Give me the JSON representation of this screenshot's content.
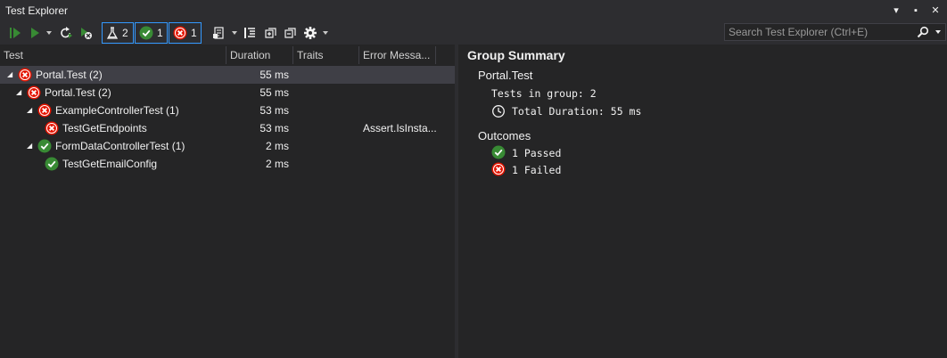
{
  "window": {
    "title": "Test Explorer",
    "controls": {
      "dropdown": "▾",
      "pin": "▪",
      "close": "✕"
    }
  },
  "toolbar": {
    "filters": [
      {
        "name": "total",
        "count": "2"
      },
      {
        "name": "passed",
        "count": "1"
      },
      {
        "name": "failed",
        "count": "1"
      }
    ],
    "search_placeholder": "Search Test Explorer (Ctrl+E)"
  },
  "columns": [
    "Test",
    "Duration",
    "Traits",
    "Error Messa..."
  ],
  "rows": [
    {
      "name": "Portal.Test  (2)",
      "status": "failed",
      "duration": "55 ms",
      "error": "",
      "level": 0,
      "expanded": true,
      "selected": true
    },
    {
      "name": "Portal.Test  (2)",
      "status": "failed",
      "duration": "55 ms",
      "error": "",
      "level": 1,
      "expanded": true,
      "selected": false
    },
    {
      "name": "ExampleControllerTest  (1)",
      "status": "failed",
      "duration": "53 ms",
      "error": "",
      "level": 2,
      "expanded": true,
      "selected": false
    },
    {
      "name": "TestGetEndpoints",
      "status": "failed",
      "duration": "53 ms",
      "error": "Assert.IsInsta...",
      "level": 3,
      "expanded": false,
      "selected": false
    },
    {
      "name": "FormDataControllerTest  (1)",
      "status": "passed",
      "duration": "2 ms",
      "error": "",
      "level": 2,
      "expanded": true,
      "selected": false
    },
    {
      "name": "TestGetEmailConfig",
      "status": "passed",
      "duration": "2 ms",
      "error": "",
      "level": 3,
      "expanded": false,
      "selected": false
    }
  ],
  "summary": {
    "title": "Group Summary",
    "group": "Portal.Test",
    "tests_in_group": "Tests in group: 2",
    "total_duration": "Total Duration: 55 ms",
    "outcomes_label": "Outcomes",
    "passed": "1 Passed",
    "failed": "1 Failed"
  },
  "colors": {
    "passed": "#388a34",
    "failed": "#e51400",
    "accent": "#3399ff"
  }
}
